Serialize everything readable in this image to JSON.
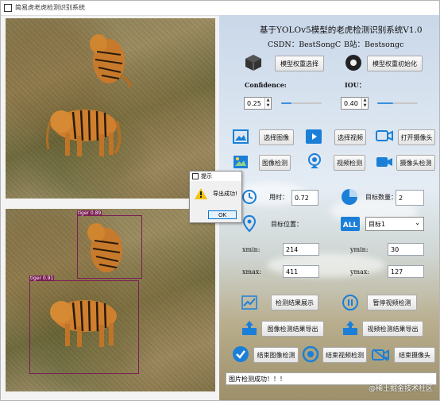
{
  "window": {
    "title": "简易虎老虎检测识别系统"
  },
  "header": {
    "title": "基于YOLOv5模型的老虎检测识别系统V1.0",
    "csdn": "CSDN：BestSongC",
    "bilibili": "B站：Bestsongc"
  },
  "model": {
    "select_label": "模型权重选择",
    "init_label": "模型权重初始化"
  },
  "params": {
    "confidence_label": "Confidence:",
    "iou_label": "IOU：",
    "confidence_value": "0.25",
    "iou_value": "0.40",
    "confidence_level": 0.25,
    "iou_level": 0.4
  },
  "actions": {
    "select_image": "选择图像",
    "select_video": "选择视频",
    "open_camera": "打开摄像头",
    "image_detect": "图像检测",
    "video_detect": "视频检测",
    "camera_detect": "摄像头检测"
  },
  "stats": {
    "time_label": "用时：",
    "time_value": "0.72",
    "count_label": "目标数量：",
    "count_value": "2",
    "position_label": "目标位置：",
    "target_select": "目标1",
    "xmin_label": "xmin:",
    "xmin_value": "214",
    "ymin_label": "ymin:",
    "ymin_value": "30",
    "xmax_label": "xmax:",
    "xmax_value": "411",
    "ymax_label": "ymax:",
    "ymax_value": "127"
  },
  "results": {
    "show": "检测结果展示",
    "pause_video": "暂停视频检测",
    "export_image": "图像检测结果导出",
    "export_video": "视频检测结果导出",
    "end_image": "结束图像检测",
    "end_video": "结束视频检测",
    "end_camera": "结束摄像头"
  },
  "status": {
    "message": "图片检测成功！！！"
  },
  "dialog": {
    "title": "提示",
    "message": "导出成功!",
    "ok": "OK"
  },
  "detections": [
    {
      "label": "tiger 0.89"
    },
    {
      "label": "tiger 0.91"
    }
  ],
  "watermark": "@稀土掘金技术社区",
  "colors": {
    "accent": "#3b8ee0",
    "bbox": "#7a1f55",
    "icon_blue": "#1b7fd8"
  }
}
